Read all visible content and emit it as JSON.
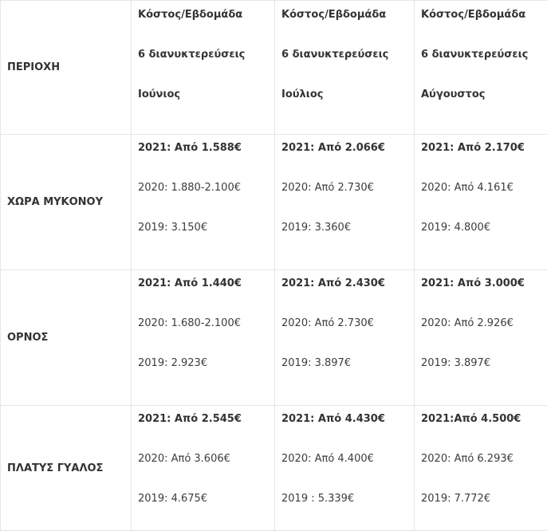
{
  "header": {
    "region_label": "ΠΕΡΙΟΧΗ",
    "columns": [
      {
        "line1": "Κόστος/Εβδομάδα",
        "line2": "6 διανυκτερεύσεις",
        "line3": "Ιούνιος"
      },
      {
        "line1": "Κόστος/Εβδομάδα",
        "line2": "6 διανυκτερεύσεις",
        "line3": "Ιούλιος"
      },
      {
        "line1": "Κόστος/Εβδομάδα",
        "line2": "6 διανυκτερεύσεις",
        "line3": "Αύγουστος"
      }
    ]
  },
  "rows": [
    {
      "region": "ΧΩΡΑ ΜΥΚΟΝΟΥ",
      "cells": [
        {
          "y2021": "2021: Από 1.588€",
          "y2020": "2020: 1.880-2.100€",
          "y2019": "2019: 3.150€"
        },
        {
          "y2021": "2021: Από 2.066€",
          "y2020": "2020: Από 2.730€",
          "y2019": "2019: 3.360€"
        },
        {
          "y2021": "2021: Από 2.170€",
          "y2020": "2020: Από 4.161€",
          "y2019": "2019: 4.800€"
        }
      ]
    },
    {
      "region": "ΟΡΝΟΣ",
      "cells": [
        {
          "y2021": "2021: Από 1.440€",
          "y2020": "2020: 1.680-2.100€",
          "y2019": "2019: 2.923€"
        },
        {
          "y2021": "2021: Από 2.430€",
          "y2020": "2020: Από 2.730€",
          "y2019": "2019: 3.897€"
        },
        {
          "y2021": "2021: Από 3.000€",
          "y2020": "2020: Από 2.926€",
          "y2019": "2019: 3.897€"
        }
      ]
    },
    {
      "region": "ΠΛΑΤΥΣ ΓΥΑΛΟΣ",
      "cells": [
        {
          "y2021": "2021: Από 2.545€",
          "y2020": "2020: Από 3.606€",
          "y2019": "2019: 4.675€"
        },
        {
          "y2021": "2021: Από 4.430€",
          "y2020": "2020: Από 4.400€",
          "y2019": "2019 : 5.339€"
        },
        {
          "y2021": "2021:Από 4.500€",
          "y2020": "2020: Από 6.293€",
          "y2019": "2019: 7.772€"
        }
      ]
    }
  ]
}
